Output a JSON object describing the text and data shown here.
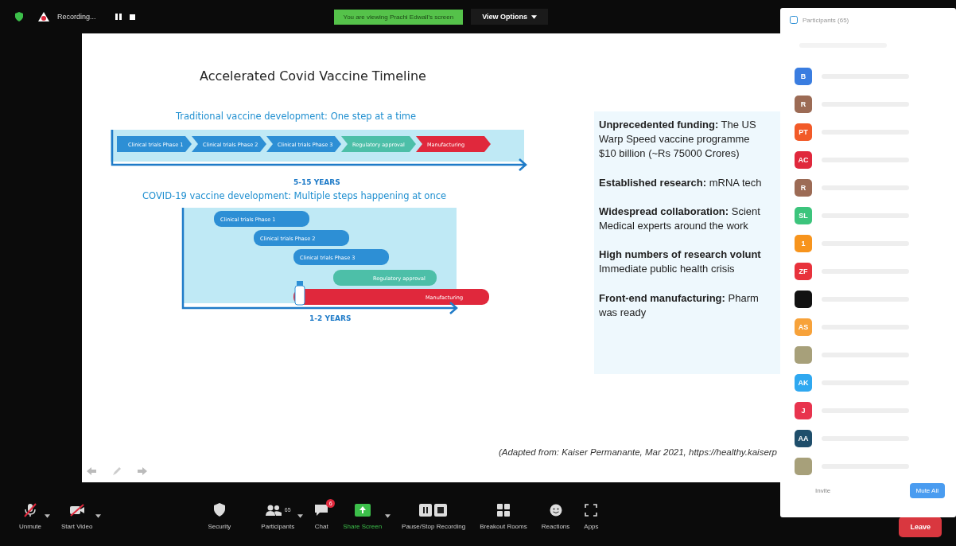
{
  "top_bar": {
    "recording_label": "Recording...",
    "banner": "You are viewing Prachi Edwall's screen",
    "view_options": "View Options"
  },
  "slide": {
    "title": "Accelerated Covid Vaccine Timeline",
    "traditional": {
      "heading": "Traditional vaccine development: One step at a time",
      "axis_label": "5-15 YEARS",
      "steps": [
        {
          "label": "Clinical trials Phase 1",
          "kind": "trial"
        },
        {
          "label": "Clinical trials Phase 2",
          "kind": "trial"
        },
        {
          "label": "Clinical trials Phase 3",
          "kind": "trial"
        },
        {
          "label": "Regulatory approval",
          "kind": "approval"
        },
        {
          "label": "Manufacturing",
          "kind": "manufacturing"
        }
      ]
    },
    "covid": {
      "heading": "COVID-19 vaccine development: Multiple steps happening at once",
      "axis_label": "1-2 YEARS",
      "steps": [
        {
          "label": "Clinical trials Phase 1",
          "kind": "trial"
        },
        {
          "label": "Clinical trials Phase 2",
          "kind": "trial"
        },
        {
          "label": "Clinical trials Phase 3",
          "kind": "trial"
        },
        {
          "label": "Regulatory approval",
          "kind": "approval"
        },
        {
          "label": "Manufacturing",
          "kind": "manufacturing"
        }
      ]
    },
    "points": [
      {
        "lines": [
          "**Unprecedented funding:** The US",
          "Warp Speed vaccine programme",
          "$10 billion (~Rs 75000 Crores)"
        ]
      },
      {
        "lines": [
          "**Established research:** mRNA tech"
        ]
      },
      {
        "lines": [
          "**Widespread collaboration:** Scient",
          "Medical experts around the work"
        ]
      },
      {
        "lines": [
          "**High numbers of research volunt**",
          "Immediate public health crisis"
        ]
      },
      {
        "lines": [
          "**Front-end manufacturing:** Pharm",
          "was ready"
        ]
      }
    ],
    "source": "(Adapted from: Kaiser Permanante, Mar 2021, https://healthy.kaiserp"
  },
  "participants": {
    "title": "Participants (65)",
    "members": [
      {
        "kind": "initials",
        "initials": "B",
        "color": "#3a7de0"
      },
      {
        "kind": "initials",
        "initials": "R",
        "color": "#9c6b55"
      },
      {
        "kind": "initials",
        "initials": "PT",
        "color": "#f25a28"
      },
      {
        "kind": "initials",
        "initials": "AC",
        "color": "#e0283c"
      },
      {
        "kind": "initials",
        "initials": "R",
        "color": "#9c6b55"
      },
      {
        "kind": "initials",
        "initials": "SL",
        "color": "#3cc47c"
      },
      {
        "kind": "initials",
        "initials": "1",
        "color": "#f7941d"
      },
      {
        "kind": "initials",
        "initials": "ZF",
        "color": "#e8323c"
      },
      {
        "kind": "initials",
        "color": "#111111"
      },
      {
        "kind": "initials",
        "initials": "AS",
        "color": "#f7a23a"
      },
      {
        "kind": "photo"
      },
      {
        "kind": "initials",
        "initials": "AK",
        "color": "#2fa8f0"
      },
      {
        "kind": "initials",
        "initials": "J",
        "color": "#e8344e"
      },
      {
        "kind": "initials",
        "initials": "AA",
        "color": "#1f4e6b"
      },
      {
        "kind": "photo"
      }
    ],
    "invite": "Invite",
    "mute_all": "Mute All"
  },
  "toolbar": {
    "items": [
      {
        "kind": "mic",
        "label": "Unmute",
        "caret": true
      },
      {
        "kind": "video",
        "label": "Start Video",
        "caret": true
      },
      {
        "kind": "security",
        "label": "Security",
        "caret": false
      },
      {
        "kind": "participants",
        "label": "Participants",
        "count": "65",
        "caret": true
      },
      {
        "kind": "chat",
        "label": "Chat",
        "badge": "6",
        "caret": false
      },
      {
        "kind": "share",
        "label": "Share Screen",
        "caret": true
      },
      {
        "kind": "recording",
        "label": "Pause/Stop Recording",
        "caret": false
      },
      {
        "kind": "breakout",
        "label": "Breakout Rooms",
        "caret": false
      },
      {
        "kind": "reactions",
        "label": "Reactions",
        "caret": false
      },
      {
        "kind": "apps",
        "label": "Apps",
        "caret": false
      }
    ],
    "leave": "Leave"
  }
}
